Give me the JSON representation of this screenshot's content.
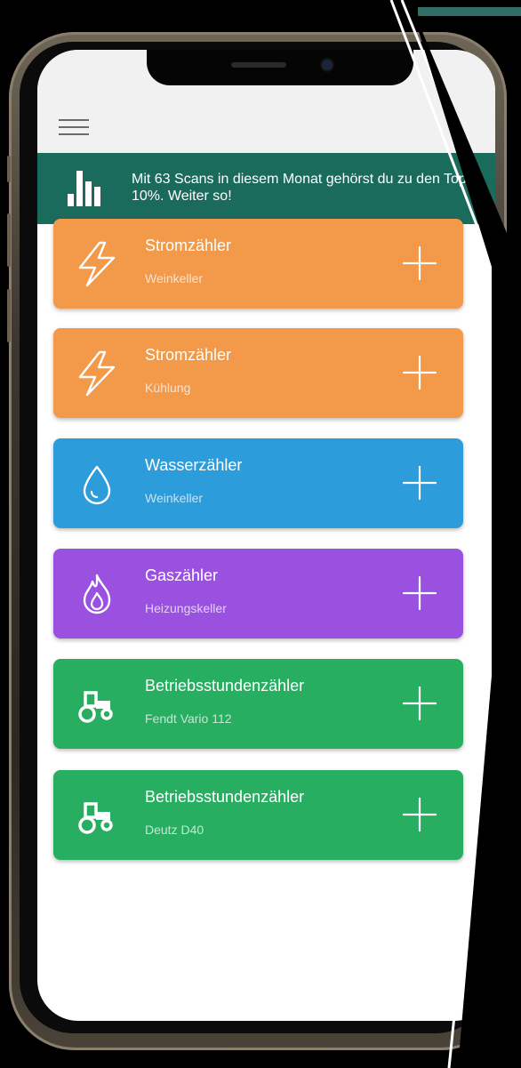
{
  "banner": {
    "text": "Mit 63 Scans in diesem Monat gehörst du zu den Top 10%. Weiter so!",
    "icon": "bar-chart-icon"
  },
  "menu": {
    "icon": "hamburger-menu-icon"
  },
  "meters": [
    {
      "title": "Stromzähler",
      "subtitle": "Weinkeller",
      "icon": "lightning-icon",
      "color": "#f2994a"
    },
    {
      "title": "Stromzähler",
      "subtitle": "Kühlung",
      "icon": "lightning-icon",
      "color": "#f2994a"
    },
    {
      "title": "Wasserzähler",
      "subtitle": "Weinkeller",
      "icon": "water-drop-icon",
      "color": "#2d9cdb"
    },
    {
      "title": "Gaszähler",
      "subtitle": "Heizungskeller",
      "icon": "flame-icon",
      "color": "#9b51e0"
    },
    {
      "title": "Betriebsstundenzähler",
      "subtitle": "Fendt Vario 112",
      "icon": "tractor-icon",
      "color": "#27ae60"
    },
    {
      "title": "Betriebsstundenzähler",
      "subtitle": "Deutz D40",
      "icon": "tractor-icon",
      "color": "#27ae60"
    }
  ],
  "colors": {
    "banner": "#1b6b5d",
    "app_bar": "#f1f1f1",
    "accent_strip": "#2f6e66"
  }
}
